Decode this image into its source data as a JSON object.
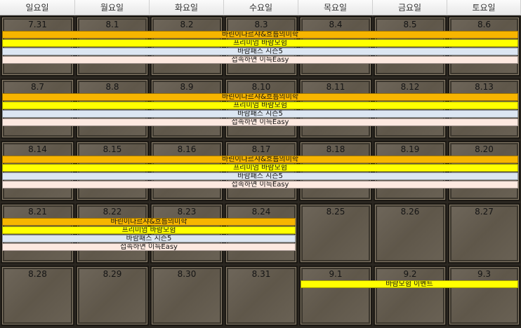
{
  "weekdays": [
    "일요일",
    "월요일",
    "화요일",
    "수요일",
    "목요일",
    "금요일",
    "토요일"
  ],
  "weeks": [
    {
      "dates": [
        "7.31",
        "8.1",
        "8.2",
        "8.3",
        "8.4",
        "8.5",
        "8.6"
      ],
      "events": [
        {
          "label": "바린이나르샤&흐름의미학",
          "start": 0,
          "span": 7,
          "color": "#f7b500"
        },
        {
          "label": "프리미엄 바람모험",
          "start": 0,
          "span": 7,
          "color": "#ffff00"
        },
        {
          "label": "바람패스 시즌5",
          "start": 0,
          "span": 7,
          "color": "#dce6f2"
        },
        {
          "label": "접속하면 이득Easy",
          "start": 0,
          "span": 7,
          "color": "#fde9e0"
        }
      ]
    },
    {
      "dates": [
        "8.7",
        "8.8",
        "8.9",
        "8.10",
        "8.11",
        "8.12",
        "8.13"
      ],
      "events": [
        {
          "label": "바린이나르샤&흐름의미학",
          "start": 0,
          "span": 7,
          "color": "#f7b500"
        },
        {
          "label": "프리미엄 바람모험",
          "start": 0,
          "span": 7,
          "color": "#ffff00"
        },
        {
          "label": "바람패스 시즌5",
          "start": 0,
          "span": 7,
          "color": "#dce6f2"
        },
        {
          "label": "접속하면 이득Easy",
          "start": 0,
          "span": 7,
          "color": "#fde9e0"
        }
      ]
    },
    {
      "dates": [
        "8.14",
        "8.15",
        "8.16",
        "8.17",
        "8.18",
        "8.19",
        "8.20"
      ],
      "events": [
        {
          "label": "바린이나르샤&흐름의미학",
          "start": 0,
          "span": 7,
          "color": "#f7b500"
        },
        {
          "label": "프리미엄 바람모험",
          "start": 0,
          "span": 7,
          "color": "#ffff00"
        },
        {
          "label": "바람패스 시즌5",
          "start": 0,
          "span": 7,
          "color": "#dce6f2"
        },
        {
          "label": "접속하면 이득Easy",
          "start": 0,
          "span": 7,
          "color": "#fde9e0"
        }
      ]
    },
    {
      "dates": [
        "8.21",
        "8.22",
        "8.23",
        "8.24",
        "8.25",
        "8.26",
        "8.27"
      ],
      "events": [
        {
          "label": "바린이나르샤&흐름의미학",
          "start": 0,
          "span": 4,
          "color": "#f7b500"
        },
        {
          "label": "프리미엄 바람모험",
          "start": 0,
          "span": 4,
          "color": "#ffff00"
        },
        {
          "label": "바람패스 시즌5",
          "start": 0,
          "span": 4,
          "color": "#dce6f2"
        },
        {
          "label": "접속하면 이득Easy",
          "start": 0,
          "span": 4,
          "color": "#fde9e0"
        }
      ]
    },
    {
      "dates": [
        "8.28",
        "8.29",
        "8.30",
        "8.31",
        "9.1",
        "9.2",
        "9.3"
      ],
      "events": [
        {
          "label": "바람모험 이벤트",
          "start": 4,
          "span": 3,
          "color": "#ffff00"
        }
      ]
    }
  ]
}
